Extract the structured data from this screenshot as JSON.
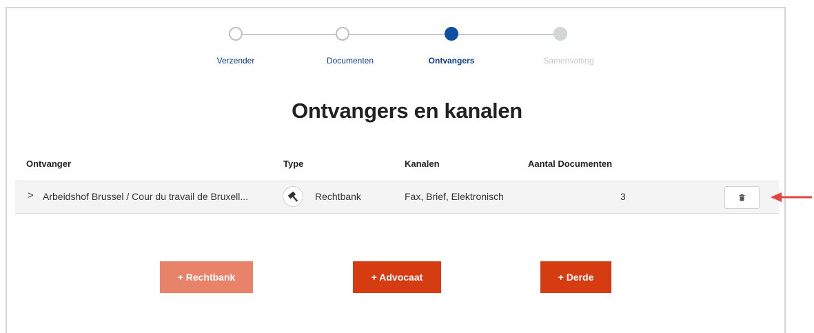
{
  "stepper": {
    "steps": [
      {
        "label": "Verzender",
        "state": "done"
      },
      {
        "label": "Documenten",
        "state": "done"
      },
      {
        "label": "Ontvangers",
        "state": "active"
      },
      {
        "label": "Samenvatting",
        "state": "future"
      }
    ]
  },
  "page_title": "Ontvangers en kanalen",
  "table": {
    "headers": {
      "recipient": "Ontvanger",
      "type": "Type",
      "channels": "Kanalen",
      "doc_count": "Aantal Documenten"
    },
    "rows": [
      {
        "expand_glyph": ">",
        "recipient": "Arbeidshof Brussel / Cour du travail de Bruxell...",
        "type_icon": "gavel-icon",
        "type": "Rechtbank",
        "channels": "Fax, Brief, Elektronisch",
        "doc_count": "3",
        "delete_icon": "trash-icon"
      }
    ]
  },
  "buttons": {
    "add_court": "+ Rechtbank",
    "add_lawyer": "+ Advocaat",
    "add_third_party": "+ Derde"
  },
  "colors": {
    "accent_blue": "#0e4fa0",
    "primary_red": "#d63c12",
    "disabled_red": "#e88268",
    "annotation_arrow": "#e2453a"
  }
}
